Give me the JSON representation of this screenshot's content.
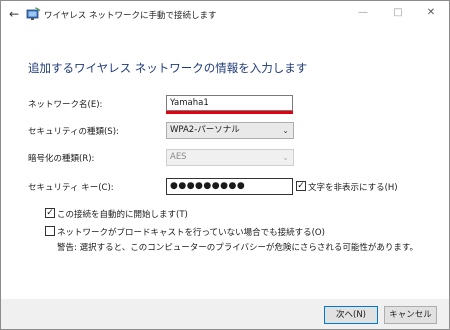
{
  "window": {
    "title": "ワイヤレス ネットワークに手動で接続します",
    "back_icon": "←",
    "minimize": "—",
    "maximize": "□",
    "close": "✕"
  },
  "heading": "追加するワイヤレス ネットワークの情報を入力します",
  "form": {
    "network_name_label": "ネットワーク名(E):",
    "network_name_value": "Yamaha1",
    "security_type_label": "セキュリティの種類(S):",
    "security_type_value": "WPA2-パーソナル",
    "encryption_type_label": "暗号化の種類(R):",
    "encryption_type_value": "AES",
    "security_key_label": "セキュリティ キー(C):",
    "security_key_value": "●●●●●●●●●",
    "hide_chars_label": "文字を非表示にする(H)",
    "hide_chars_checked": true,
    "auto_connect_label": "この接続を自動的に開始します(T)",
    "auto_connect_checked": true,
    "connect_hidden_label": "ネットワークがブロードキャストを行っていない場合でも接続する(O)",
    "connect_hidden_checked": false,
    "warning_text": "警告: 選択すると、このコンピューターのプライバシーが危険にさらされる可能性があります。"
  },
  "buttons": {
    "next": "次へ(N)",
    "cancel": "キャンセル"
  },
  "colors": {
    "heading": "#1f3a7a",
    "highlight_underline": "#e3000f",
    "default_button_border": "#0078d7"
  }
}
